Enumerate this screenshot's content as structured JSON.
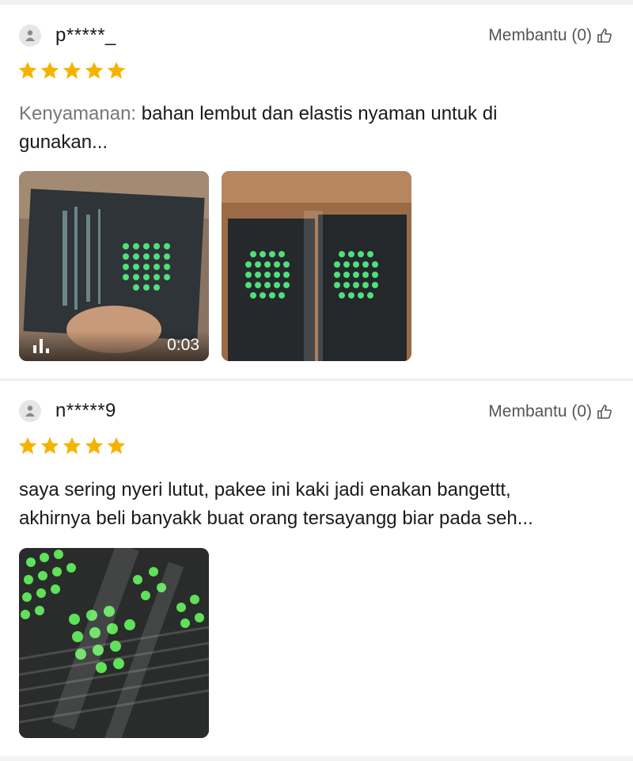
{
  "reviews": [
    {
      "username": "p*****_",
      "helpful_label": "Membantu (0)",
      "rating": 5,
      "text_label": "Kenyamanan:",
      "text": "bahan lembut dan elastis nyaman untuk di",
      "text_line2": "gunakan...",
      "media": [
        {
          "type": "video",
          "duration": "0:03",
          "icon": "play-stats-icon"
        },
        {
          "type": "image"
        }
      ]
    },
    {
      "username": "n*****9",
      "helpful_label": "Membantu (0)",
      "rating": 5,
      "text_line1": "saya sering nyeri lutut, pakee ini kaki jadi enakan bangettt,",
      "text_line2": "akhirnya beli banyakk buat  orang tersayangg biar pada seh...",
      "media": [
        {
          "type": "image"
        }
      ]
    }
  ],
  "colors": {
    "star": "#f5b301",
    "muted_text": "#777777",
    "avatar_bg": "#e6e6e6",
    "green_dots": "#4fe07a"
  }
}
